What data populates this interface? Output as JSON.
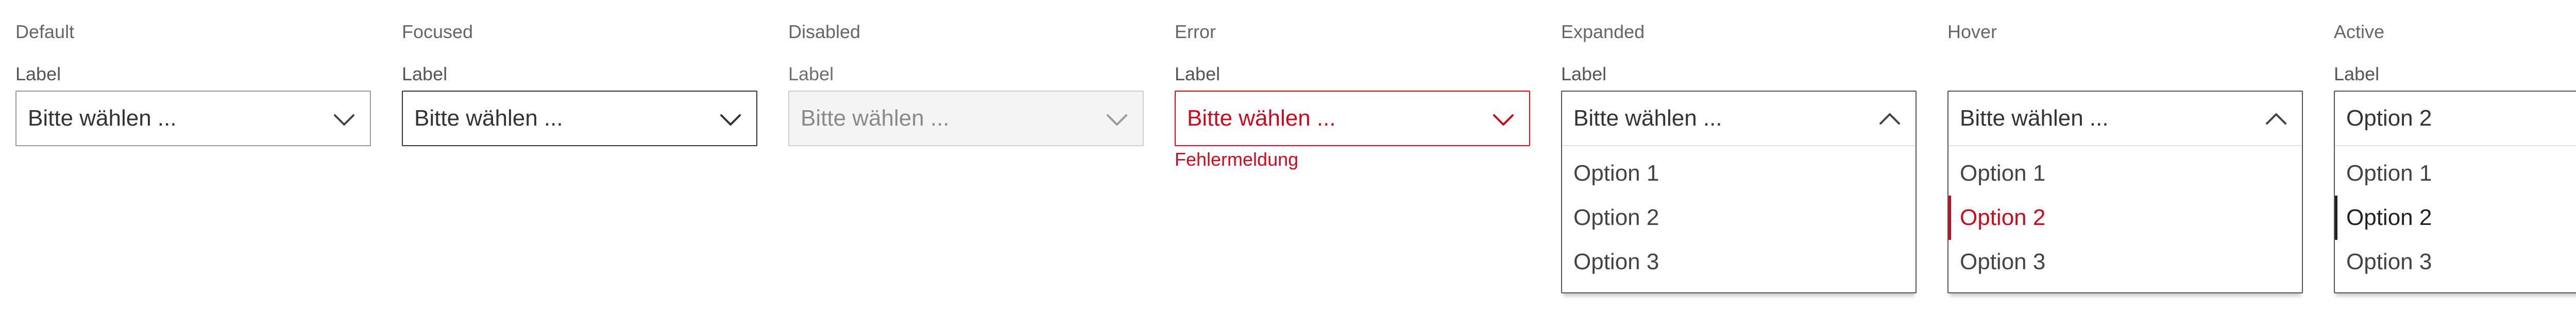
{
  "states": [
    {
      "title": "Default",
      "label": "Label",
      "value": "Bitte wählen ..."
    },
    {
      "title": "Focused",
      "label": "Label",
      "value": "Bitte wählen ..."
    },
    {
      "title": "Disabled",
      "label": "Label",
      "value": "Bitte wählen ..."
    },
    {
      "title": "Error",
      "label": "Label",
      "value": "Bitte wählen ...",
      "error_message": "Fehlermeldung"
    },
    {
      "title": "Expanded",
      "label": "Label",
      "value": "Bitte wählen ...",
      "options": [
        "Option 1",
        "Option 2",
        "Option 3"
      ]
    },
    {
      "title": "Hover",
      "label": "",
      "value": "Bitte wählen ...",
      "options": [
        "Option 1",
        "Option 2",
        "Option 3"
      ],
      "hovered_option": "Option 2"
    },
    {
      "title": "Active",
      "label": "Label",
      "value": "Option 2",
      "options": [
        "Option 1",
        "Option 2",
        "Option 3"
      ],
      "selected_option": "Option 2"
    }
  ],
  "icons": {
    "collapsed": "chevron-down-icon",
    "expanded": "chevron-up-icon"
  },
  "colors": {
    "error": "#cc0a1e",
    "border_default": "#9a9a9a",
    "border_focused": "#333333",
    "disabled_bg": "#f4f4f4",
    "text": "#333333"
  }
}
